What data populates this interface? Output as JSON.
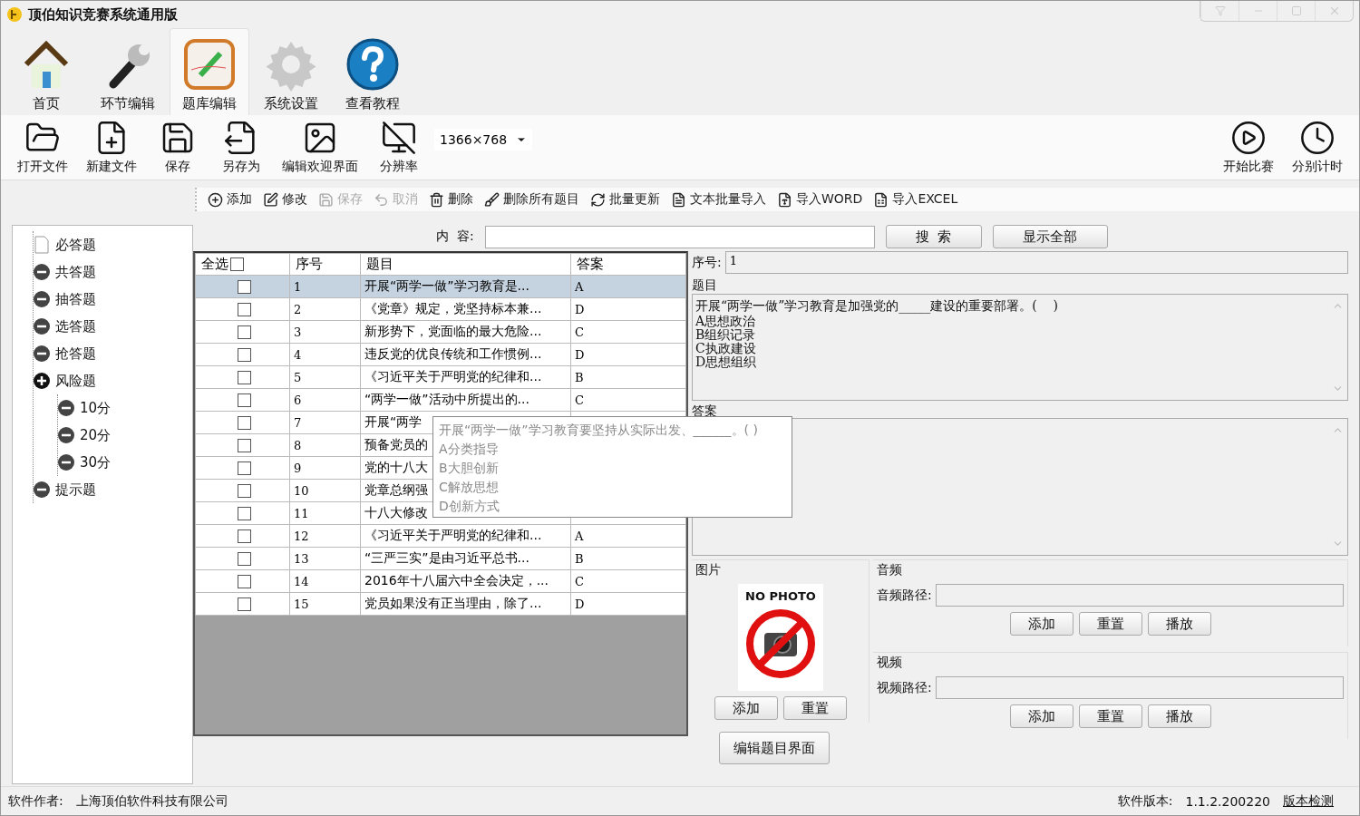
{
  "window": {
    "title": "顶伯知识竞赛系统通用版"
  },
  "ribbon_tabs": [
    {
      "label": "首页",
      "kind": "home",
      "selected": false
    },
    {
      "label": "环节编辑",
      "kind": "wrench",
      "selected": false
    },
    {
      "label": "题库编辑",
      "kind": "notepad",
      "selected": true
    },
    {
      "label": "系统设置",
      "kind": "gear",
      "selected": false
    },
    {
      "label": "查看教程",
      "kind": "help",
      "selected": false
    }
  ],
  "toolbar": {
    "items": [
      {
        "label": "打开文件",
        "kind": "open"
      },
      {
        "label": "新建文件",
        "kind": "new"
      },
      {
        "label": "保存",
        "kind": "save"
      },
      {
        "label": "另存为",
        "kind": "saveas"
      },
      {
        "label": "编辑欢迎界面",
        "kind": "image"
      },
      {
        "label": "分辨率",
        "kind": "monitor"
      }
    ],
    "resolution": "1366×768",
    "right_items": [
      {
        "label": "开始比赛",
        "kind": "play"
      },
      {
        "label": "分别计时",
        "kind": "clock"
      }
    ]
  },
  "actions": [
    {
      "label": "添加",
      "kind": "add",
      "disabled": false
    },
    {
      "label": "修改",
      "kind": "edit",
      "disabled": false
    },
    {
      "label": "保存",
      "kind": "save",
      "disabled": true
    },
    {
      "label": "取消",
      "kind": "undo",
      "disabled": true
    },
    {
      "label": "删除",
      "kind": "delete",
      "disabled": false
    },
    {
      "label": "删除所有题目",
      "kind": "clear",
      "disabled": false
    },
    {
      "label": "批量更新",
      "kind": "refresh",
      "disabled": false
    },
    {
      "label": "文本批量导入",
      "kind": "text",
      "disabled": false
    },
    {
      "label": "导入WORD",
      "kind": "word",
      "disabled": false
    },
    {
      "label": "导入EXCEL",
      "kind": "excel",
      "disabled": false
    }
  ],
  "tree": [
    {
      "label": "必答题",
      "kind": "page"
    },
    {
      "label": "共答题",
      "kind": "minus"
    },
    {
      "label": "抽答题",
      "kind": "minus"
    },
    {
      "label": "选答题",
      "kind": "minus"
    },
    {
      "label": "抢答题",
      "kind": "minus"
    },
    {
      "label": "风险题",
      "kind": "plus",
      "children": [
        {
          "label": "10分",
          "kind": "minus"
        },
        {
          "label": "20分",
          "kind": "minus"
        },
        {
          "label": "30分",
          "kind": "minus"
        }
      ]
    },
    {
      "label": "提示题",
      "kind": "minus"
    }
  ],
  "search": {
    "label": "内  容:",
    "buttons": [
      "搜  索",
      "显示全部"
    ]
  },
  "table": {
    "select_all": "全选",
    "select_all_checked": false,
    "columns": [
      "序号",
      "题目",
      "答案"
    ],
    "rows": [
      {
        "no": "1",
        "title": "开展“两学一做”学习教育是...",
        "answer": "A",
        "checked": false,
        "selected": true
      },
      {
        "no": "2",
        "title": "《党章》规定，党坚持标本兼...",
        "answer": "D",
        "checked": false,
        "selected": false
      },
      {
        "no": "3",
        "title": "新形势下，党面临的最大危险...",
        "answer": "C",
        "checked": false,
        "selected": false
      },
      {
        "no": "4",
        "title": "违反党的优良传统和工作惯例...",
        "answer": "D",
        "checked": false,
        "selected": false
      },
      {
        "no": "5",
        "title": "《习近平关于严明党的纪律和...",
        "answer": "B",
        "checked": false,
        "selected": false
      },
      {
        "no": "6",
        "title": "“两学一做”活动中所提出的...",
        "answer": "C",
        "checked": false,
        "selected": false
      },
      {
        "no": "7",
        "title": "开展“两学",
        "checked": false,
        "selected": false
      },
      {
        "no": "8",
        "title": "预备党员的",
        "checked": false,
        "selected": false
      },
      {
        "no": "9",
        "title": "党的十八大",
        "checked": false,
        "selected": false
      },
      {
        "no": "10",
        "title": "党章总纲强",
        "checked": false,
        "selected": false
      },
      {
        "no": "11",
        "title": "十八大修改",
        "checked": false,
        "selected": false
      },
      {
        "no": "12",
        "title": "《习近平关于严明党的纪律和...",
        "answer": "A",
        "checked": false,
        "selected": false
      },
      {
        "no": "13",
        "title": "“三严三实”是由习近平总书...",
        "answer": "B",
        "checked": false,
        "selected": false
      },
      {
        "no": "14",
        "title": "2016年十八届六中全会决定，...",
        "answer": "C",
        "checked": false,
        "selected": false
      },
      {
        "no": "15",
        "title": "党员如果没有正当理由，除了...",
        "answer": "D",
        "checked": false,
        "selected": false
      }
    ]
  },
  "tooltip": {
    "lines": [
      "开展“两学一做”学习教育要坚持从实际出发、______。(  )",
      "A分类指导",
      "B大胆创新",
      "C解放思想",
      "D创新方式"
    ]
  },
  "detail": {
    "no_label": "序号:",
    "no_value": "1",
    "question_label": "题目",
    "question_lines": [
      "开展“两学一做”学习教育是加强党的_____建设的重要部署。(    )",
      "A思想政治",
      "B组织记录",
      "C执政建设",
      "D思想组织"
    ],
    "answer_label": "答案",
    "picture": {
      "label": "图片",
      "placeholder": "NO PHOTO",
      "buttons": [
        "添加",
        "重置"
      ]
    },
    "audio": {
      "label": "音频",
      "path_label": "音频路径:",
      "buttons": [
        "添加",
        "重置",
        "播放"
      ]
    },
    "video": {
      "label": "视频",
      "path_label": "视频路径:",
      "buttons": [
        "添加",
        "重置",
        "播放"
      ]
    },
    "edit_button": "编辑题目界面"
  },
  "status_bar": {
    "author_label": "软件作者:",
    "author": "上海顶伯软件科技有限公司",
    "version_label": "软件版本:",
    "version": "1.1.2.200220",
    "check_link": "版本检测"
  }
}
